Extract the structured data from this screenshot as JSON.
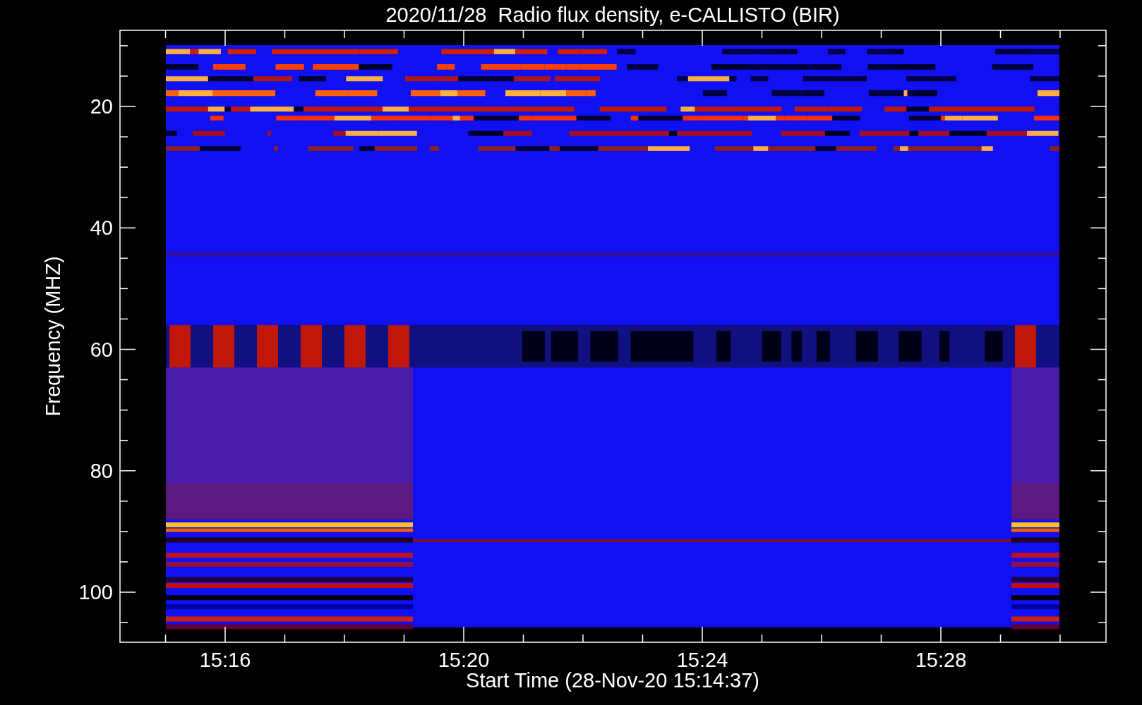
{
  "plot": {
    "title": "2020/11/28  Radio flux density, e-CALLISTO (BIR)",
    "ylabel": "Frequency (MHZ)",
    "yticks": [
      "20",
      "40",
      "60",
      "80",
      "100"
    ],
    "xlabel": "Start Time (28-Nov-20 15:14:37)",
    "xticks": [
      "15:16",
      "15:20",
      "15:24",
      "15:28"
    ]
  }
}
